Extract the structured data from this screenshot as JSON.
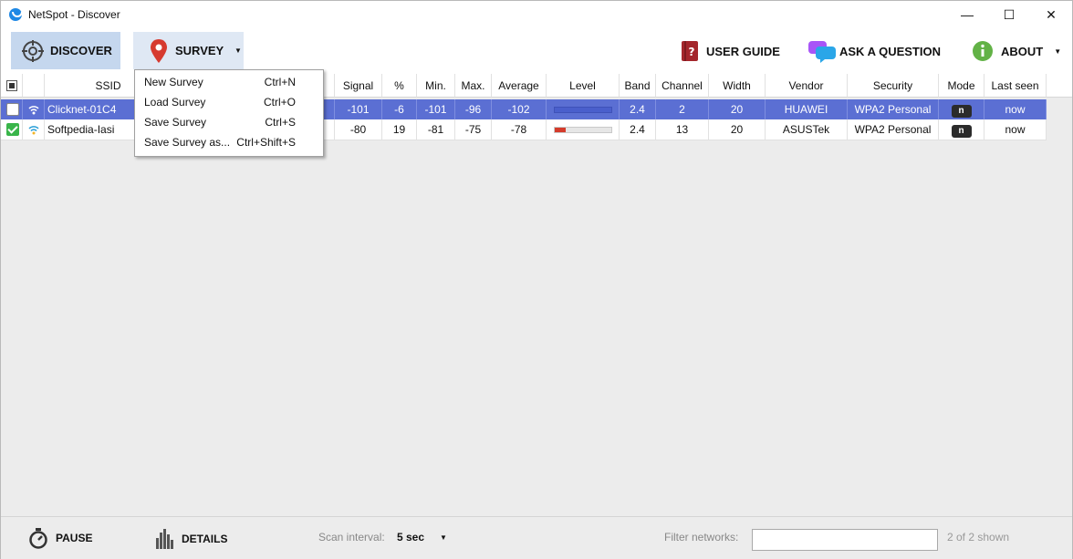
{
  "window": {
    "title": "NetSpot - Discover",
    "minimize": "—",
    "maximize": "☐",
    "close": "✕"
  },
  "toolbar": {
    "discover_label": "DISCOVER",
    "survey_label": "SURVEY",
    "user_guide_label": "USER GUIDE",
    "ask_question_label": "ASK A QUESTION",
    "about_label": "ABOUT"
  },
  "survey_menu": [
    {
      "label": "New Survey",
      "shortcut": "Ctrl+N"
    },
    {
      "label": "Load Survey",
      "shortcut": "Ctrl+O"
    },
    {
      "label": "Save Survey",
      "shortcut": "Ctrl+S"
    },
    {
      "label": "Save Survey as...",
      "shortcut": "Ctrl+Shift+S"
    }
  ],
  "columns": {
    "ssid": "SSID",
    "signal": "Signal",
    "pct": "%",
    "min": "Min.",
    "max": "Max.",
    "average": "Average",
    "level": "Level",
    "band": "Band",
    "channel": "Channel",
    "width": "Width",
    "vendor": "Vendor",
    "security": "Security",
    "mode": "Mode",
    "last_seen": "Last seen"
  },
  "rows": [
    {
      "checked": false,
      "ssid": "Clicknet-01C4",
      "signal": "-101",
      "pct": "-6",
      "min": "-101",
      "max": "-96",
      "average": "-102",
      "level": 0.0,
      "band": "2.4",
      "channel": "2",
      "width": "20",
      "vendor": "HUAWEI",
      "security": "WPA2 Personal",
      "mode": "n",
      "last_seen": "now"
    },
    {
      "checked": true,
      "ssid": "Softpedia-Iasi",
      "signal": "-80",
      "pct": "19",
      "min": "-81",
      "max": "-75",
      "average": "-78",
      "level": 0.19,
      "band": "2.4",
      "channel": "13",
      "width": "20",
      "vendor": "ASUSTek",
      "security": "WPA2 Personal",
      "mode": "n",
      "last_seen": "now"
    }
  ],
  "bottom": {
    "pause_label": "PAUSE",
    "details_label": "DETAILS",
    "scan_interval_label": "Scan interval:",
    "scan_interval_value": "5 sec",
    "filter_label": "Filter networks:",
    "filter_value": "",
    "shown_text": "2 of 2 shown"
  },
  "colors": {
    "selected_row": "#5b6fd3",
    "level_fill": "#d43b2b",
    "toolbar_active": "#c5d7ee"
  }
}
